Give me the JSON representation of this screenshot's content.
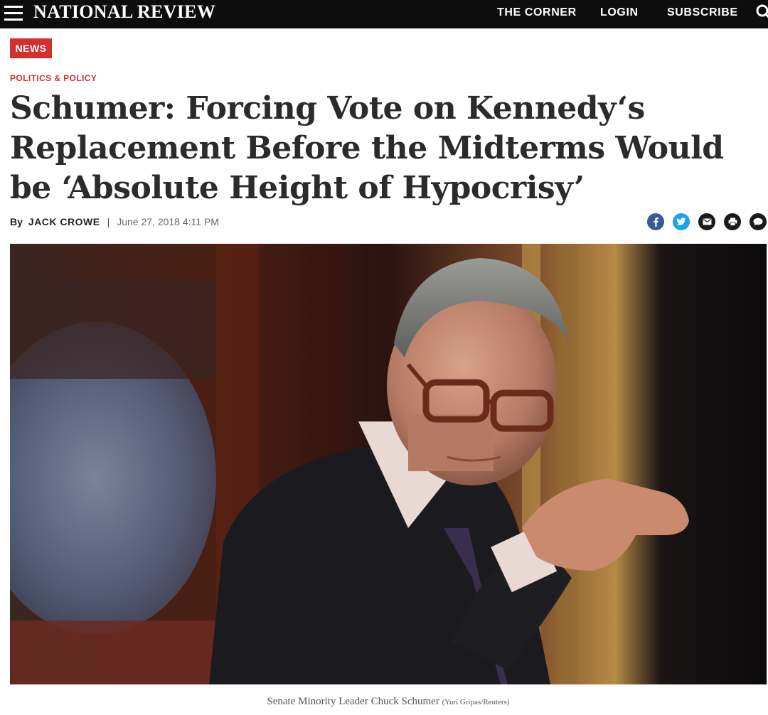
{
  "header": {
    "logo": "NATIONAL REVIEW",
    "nav": {
      "corner": "THE CORNER",
      "login": "LOGIN",
      "subscribe": "SUBSCRIBE"
    },
    "icons": [
      "hamburger-menu-icon",
      "search-icon"
    ]
  },
  "article": {
    "badge": "NEWS",
    "category": "POLITICS & POLICY",
    "headline": "Schumer: Forcing Vote on Kennedy‘s Replacement Before the Midterms Would be ‘Absolute Height of Hypocrisy’",
    "byline": {
      "by": "By",
      "author": "JACK CROWE",
      "separator": "|",
      "date": "June 27, 2018 4:11 PM"
    },
    "share_icons": [
      "facebook-icon",
      "twitter-icon",
      "email-icon",
      "print-icon",
      "comments-icon"
    ],
    "photo": {
      "caption": "Senate Minority Leader Chuck Schumer",
      "credit": "(Yuri Gripas/Reuters)"
    }
  },
  "colors": {
    "topbar": "#0d0d0d",
    "accent_red": "#d32f2f",
    "headline": "#2b2b2b",
    "facebook": "#3b5998",
    "twitter": "#1da1f2"
  }
}
